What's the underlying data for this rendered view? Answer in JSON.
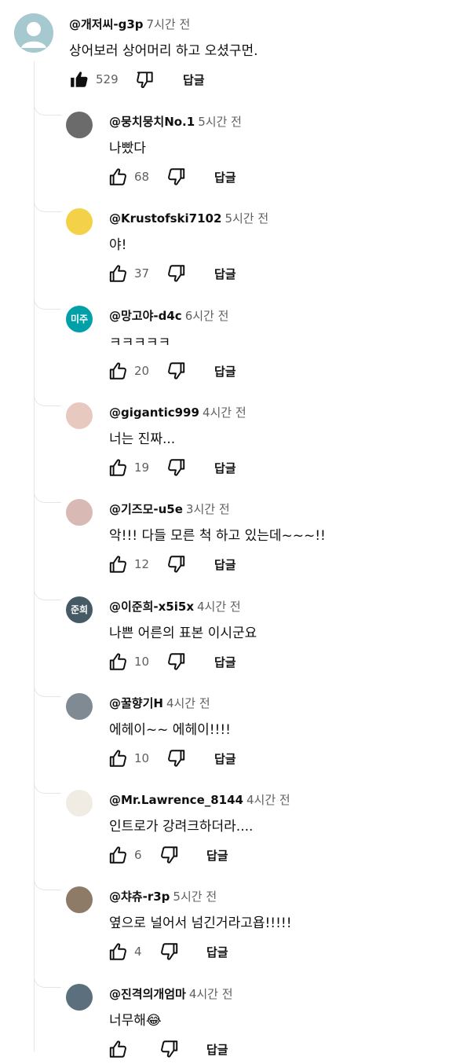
{
  "top_comment": {
    "author": "@개저씨-g3p",
    "time": "7시간 전",
    "text": "상어보러 상어머리 하고 오셨구먼.",
    "likes": "529",
    "reply_label": "답글",
    "like_icon": "thumbs-up-filled-icon",
    "dislike_icon": "thumbs-down-icon"
  },
  "replies": [
    {
      "author": "@뭉치뭉치No.1",
      "time": "5시간 전",
      "text": "나빴다",
      "likes": "68",
      "reply_label": "답글",
      "avatar_color": "#6b6b6b"
    },
    {
      "author": "@Krustofski7102",
      "time": "5시간 전",
      "text": "야!",
      "likes": "37",
      "reply_label": "답글",
      "avatar_color": "#f3d24a"
    },
    {
      "author": "@망고야-d4c",
      "time": "6시간 전",
      "text": "ㅋㅋㅋㅋㅋ",
      "likes": "20",
      "reply_label": "답글",
      "avatar_initials": "미주",
      "avatar_color": "#00a0a8"
    },
    {
      "author": "@gigantic999",
      "time": "4시간 전",
      "text": "너는 진짜...",
      "likes": "19",
      "reply_label": "답글",
      "avatar_color": "#e8c9c0"
    },
    {
      "author": "@기즈모-u5e",
      "time": "3시간 전",
      "text": "악!!! 다들 모른 척 하고 있는데~~~!!",
      "likes": "12",
      "reply_label": "답글",
      "avatar_color": "#d9b9b4"
    },
    {
      "author": "@이준희-x5i5x",
      "time": "4시간 전",
      "text": "나쁜 어른의 표본 이시군요",
      "likes": "10",
      "reply_label": "답글",
      "avatar_initials": "준희",
      "avatar_color": "#455a64"
    },
    {
      "author": "@꿀향기H",
      "time": "4시간 전",
      "text": "에헤이~~ 에헤이!!!!",
      "likes": "10",
      "reply_label": "답글",
      "avatar_color": "#7f8a93"
    },
    {
      "author": "@Mr.Lawrence_8144",
      "time": "4시간 전",
      "text": "인트로가 강려크하더라....",
      "likes": "6",
      "reply_label": "답글",
      "avatar_color": "#f0ece4"
    },
    {
      "author": "@챠츄-r3p",
      "time": "5시간 전",
      "text": "옆으로 널어서 넘긴거라고욥!!!!!",
      "likes": "4",
      "reply_label": "답글",
      "avatar_color": "#8d7b68"
    },
    {
      "author": "@진격의개엄마",
      "time": "4시간 전",
      "text": "너무해😂",
      "likes": "",
      "reply_label": "답글",
      "avatar_color": "#5b6f7c"
    }
  ],
  "icons": {
    "like": "thumbs-up-icon",
    "dislike": "thumbs-down-icon"
  }
}
